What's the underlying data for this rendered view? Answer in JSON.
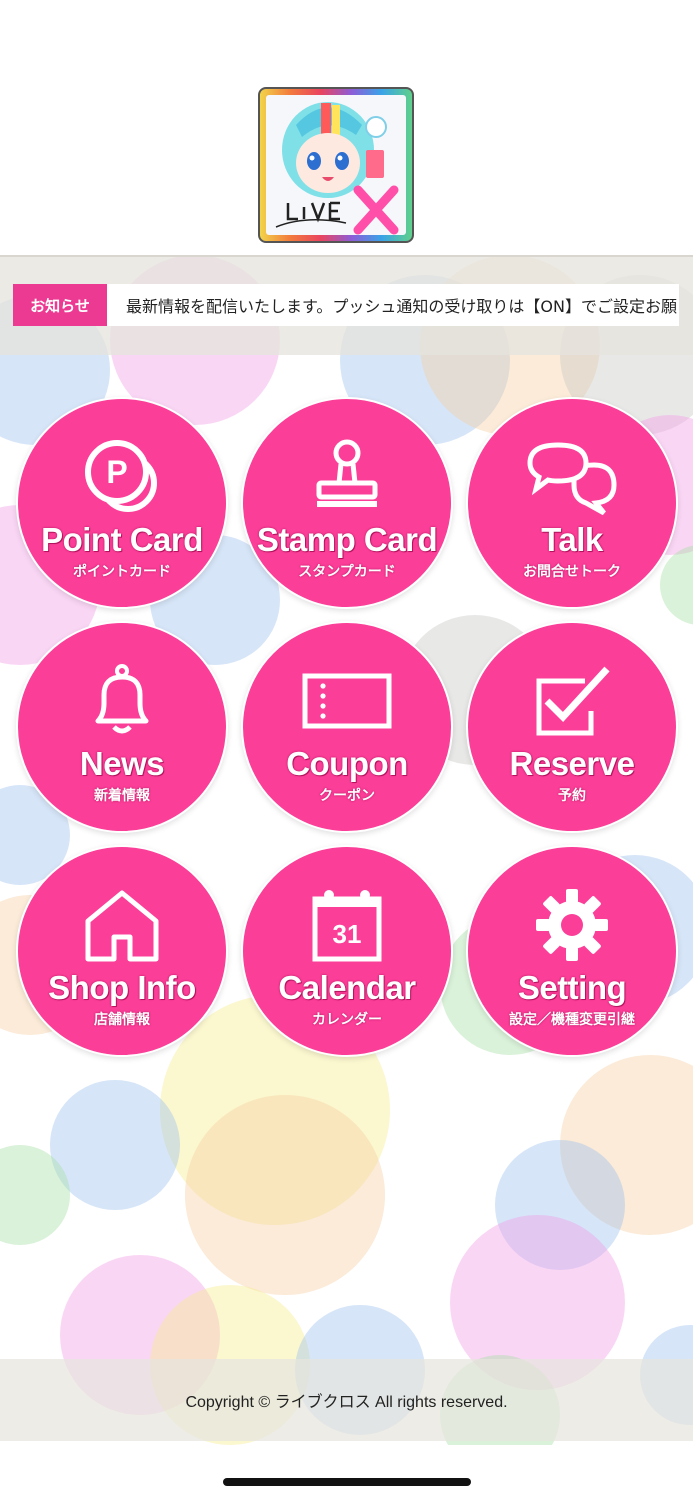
{
  "app": {
    "logo_alt": "LiVE X"
  },
  "notice": {
    "label": "お知らせ",
    "text": "最新情報を配信いたします。プッシュ通知の受け取りは【ON】でご設定お願いします。"
  },
  "menu": [
    {
      "title": "Point Card",
      "sub": "ポイントカード",
      "icon": "point-card-icon"
    },
    {
      "title": "Stamp Card",
      "sub": "スタンプカード",
      "icon": "stamp-icon"
    },
    {
      "title": "Talk",
      "sub": "お問合せトーク",
      "icon": "chat-bubbles-icon"
    },
    {
      "title": "News",
      "sub": "新着情報",
      "icon": "bell-icon"
    },
    {
      "title": "Coupon",
      "sub": "クーポン",
      "icon": "coupon-icon"
    },
    {
      "title": "Reserve",
      "sub": "予約",
      "icon": "checkbox-icon"
    },
    {
      "title": "Shop Info",
      "sub": "店舗情報",
      "icon": "house-icon"
    },
    {
      "title": "Calendar",
      "sub": "カレンダー",
      "icon": "calendar-icon",
      "day": "31"
    },
    {
      "title": "Setting",
      "sub": "設定／機種変更引継",
      "icon": "gear-icon"
    }
  ],
  "footer": {
    "copyright": "Copyright © ライブクロス All rights reserved."
  },
  "colors": {
    "accent": "#fb3e98",
    "label": "#ec3a92"
  }
}
